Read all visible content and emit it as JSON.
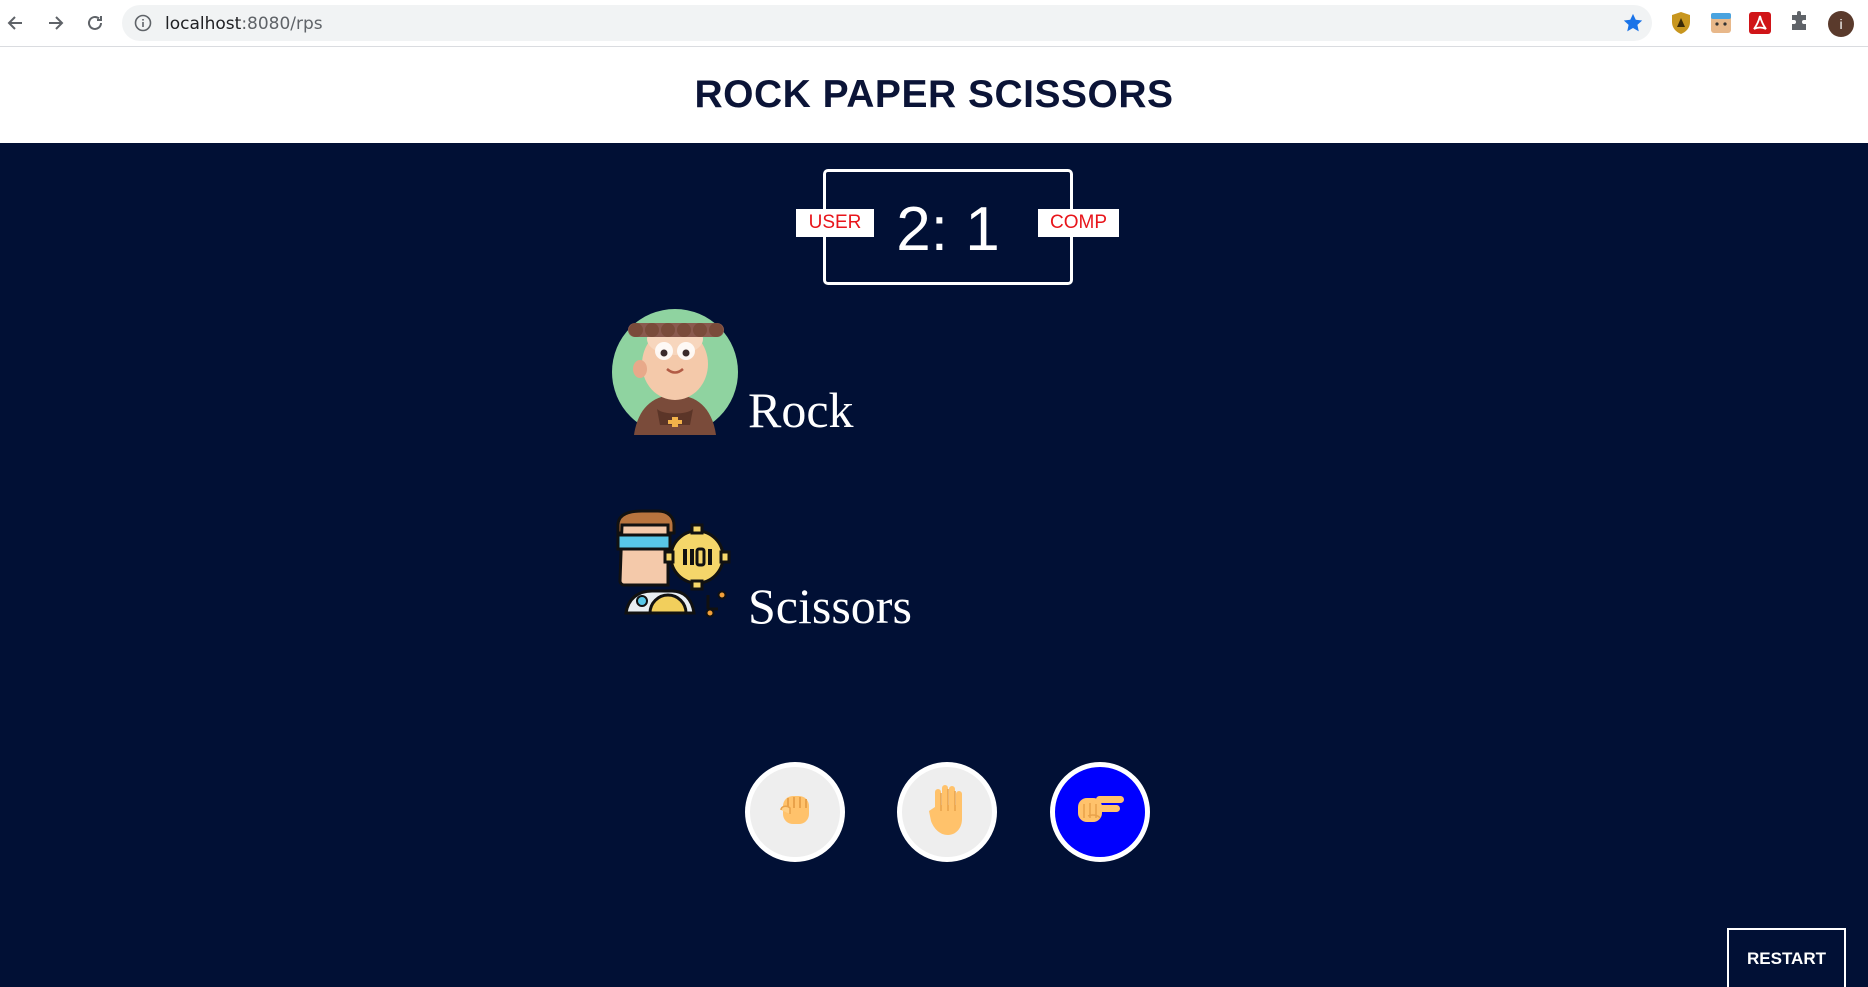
{
  "browser": {
    "url_host": "localhost",
    "url_rest": ":8080/rps"
  },
  "page": {
    "title": "ROCK PAPER SCISSORS"
  },
  "scoreboard": {
    "score": "2: 1",
    "user_label": "USER",
    "comp_label": "COMP"
  },
  "user": {
    "choice": "Rock",
    "avatar_icon": "monk-avatar-icon"
  },
  "computer": {
    "choice": "Scissors",
    "avatar_icon": "robot-avatar-icon"
  },
  "controls": {
    "buttons": [
      {
        "icon": "fist-rock-icon",
        "active": false
      },
      {
        "icon": "open-hand-paper-icon",
        "active": false
      },
      {
        "icon": "scissors-hand-icon",
        "active": true
      }
    ],
    "restart_label": "RESTART"
  },
  "colors": {
    "game_background": "#011035",
    "title_color": "#0b1437",
    "badge_text": "#e8151b",
    "active_button": "#0000ff"
  }
}
